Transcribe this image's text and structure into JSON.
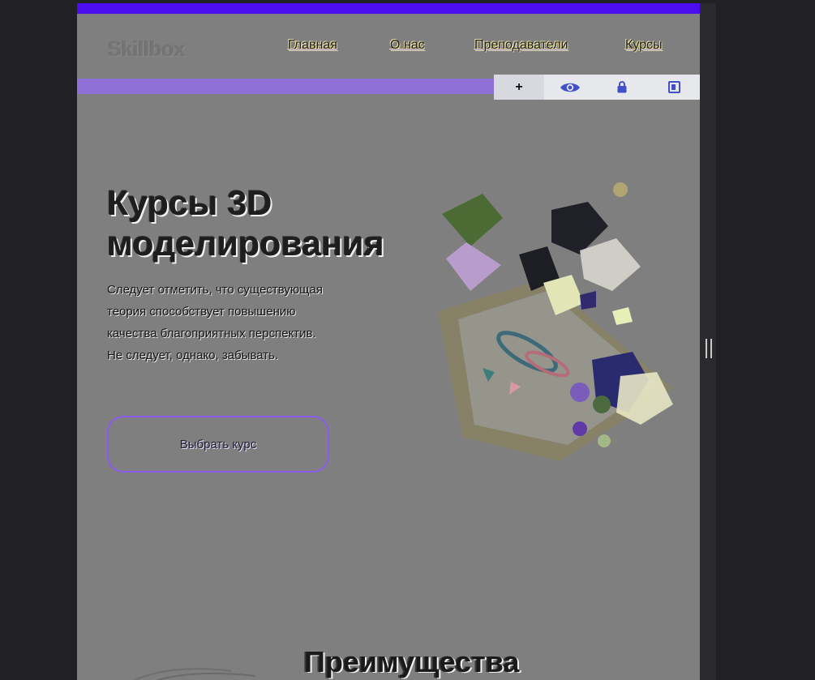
{
  "header": {
    "logo": "Skillbox",
    "nav": [
      {
        "label": "Главная"
      },
      {
        "label": "О нас"
      },
      {
        "label": "Преподаватели"
      },
      {
        "label": "Курсы"
      }
    ]
  },
  "toolbar": {
    "tools": [
      {
        "name": "add",
        "icon": "plus-icon",
        "glyph": "+"
      },
      {
        "name": "visibility",
        "icon": "eye-icon"
      },
      {
        "name": "lock",
        "icon": "lock-icon"
      },
      {
        "name": "layer",
        "icon": "layer-icon"
      }
    ]
  },
  "hero": {
    "title_line1": "Курсы 3D",
    "title_line2": "моделирования",
    "text_line1": "Следует отметить, что существующая",
    "text_line2": "теория способствует повышению",
    "text_line3": "качества благоприятных перспектив.",
    "text_line4": "Не следует, однако, забывать.",
    "cta_label": "Выбрать курс"
  },
  "advantages": {
    "title": "Преимущества"
  },
  "colors": {
    "accent": "#4b0df0",
    "strip": "#8f70d6",
    "page_bg": "#7f7f7f",
    "outer_bg": "#212123"
  }
}
